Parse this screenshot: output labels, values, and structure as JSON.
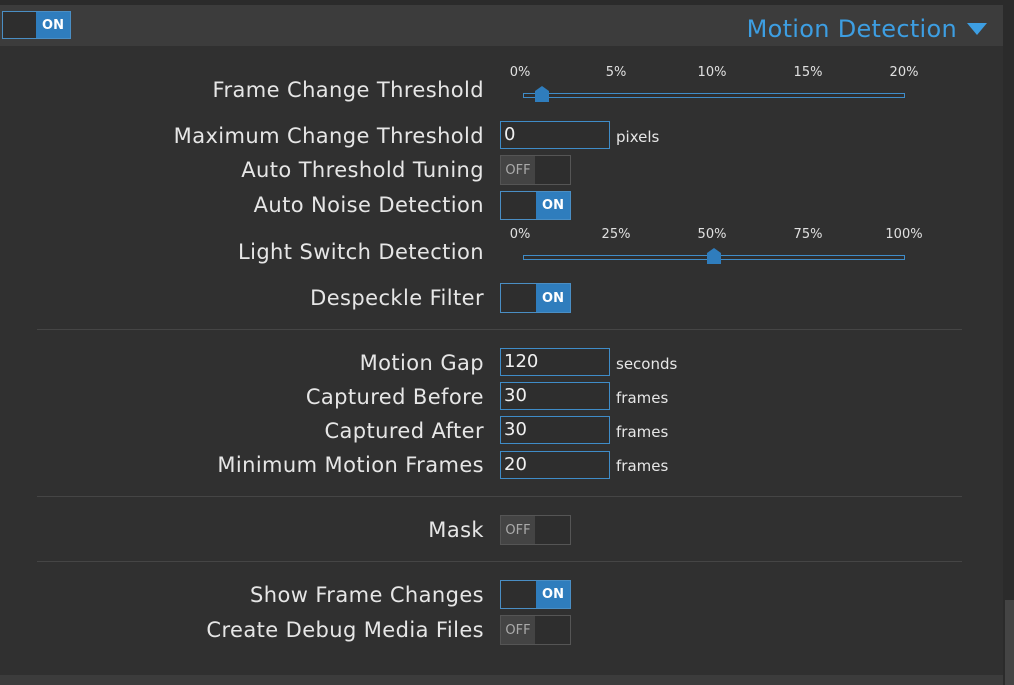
{
  "header": {
    "toggle_label": "ON",
    "title": "Motion Detection",
    "toggle_icon": "chevron-down-icon"
  },
  "frame_change_threshold": {
    "label": "Frame Change Threshold",
    "ticks": [
      "0%",
      "5%",
      "10%",
      "15%",
      "20%"
    ],
    "value_percent": 1
  },
  "max_change_threshold": {
    "label": "Maximum Change Threshold",
    "value": "0",
    "unit": "pixels"
  },
  "auto_threshold_tuning": {
    "label": "Auto Threshold Tuning",
    "state": "OFF"
  },
  "auto_noise_detection": {
    "label": "Auto Noise Detection",
    "state": "ON"
  },
  "light_switch_detection": {
    "label": "Light Switch Detection",
    "ticks": [
      "0%",
      "25%",
      "50%",
      "75%",
      "100%"
    ],
    "value_percent": 50
  },
  "despeckle_filter": {
    "label": "Despeckle Filter",
    "state": "ON"
  },
  "motion_gap": {
    "label": "Motion Gap",
    "value": "120",
    "unit": "seconds"
  },
  "captured_before": {
    "label": "Captured Before",
    "value": "30",
    "unit": "frames"
  },
  "captured_after": {
    "label": "Captured After",
    "value": "30",
    "unit": "frames"
  },
  "minimum_motion_frames": {
    "label": "Minimum Motion Frames",
    "value": "20",
    "unit": "frames"
  },
  "mask": {
    "label": "Mask",
    "state": "OFF"
  },
  "show_frame_changes": {
    "label": "Show Frame Changes",
    "state": "ON"
  },
  "create_debug_media_files": {
    "label": "Create Debug Media Files",
    "state": "OFF"
  },
  "colors": {
    "accent": "#3d9ee2",
    "toggle_on": "#2f7dbd",
    "background": "#303030"
  }
}
